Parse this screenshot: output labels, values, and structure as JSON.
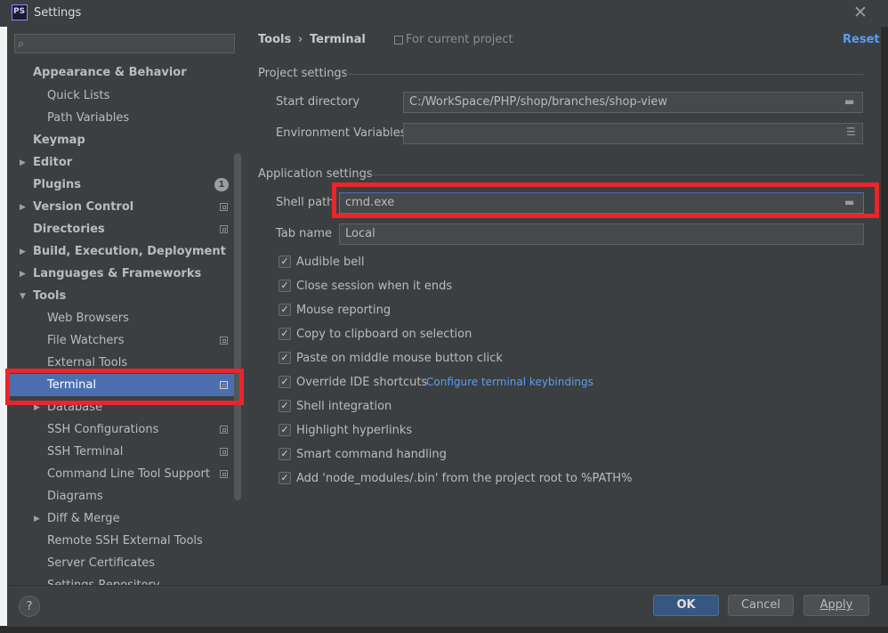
{
  "window": {
    "title": "Settings",
    "icon_text": "PS",
    "close_icon": "close-icon"
  },
  "search": {
    "placeholder": ""
  },
  "sidebar": {
    "items": [
      {
        "label": "Appearance & Behavior",
        "bold": true
      },
      {
        "label": "Quick Lists"
      },
      {
        "label": "Path Variables"
      },
      {
        "label": "Keymap",
        "bold": true
      },
      {
        "label": "Editor",
        "bold": true
      },
      {
        "label": "Plugins",
        "bold": true,
        "badge": "1"
      },
      {
        "label": "Version Control",
        "bold": true
      },
      {
        "label": "Directories",
        "bold": true
      },
      {
        "label": "Build, Execution, Deployment",
        "bold": true
      },
      {
        "label": "Languages & Frameworks",
        "bold": true
      },
      {
        "label": "Tools",
        "bold": true
      },
      {
        "label": "Web Browsers"
      },
      {
        "label": "File Watchers"
      },
      {
        "label": "External Tools"
      },
      {
        "label": "Terminal",
        "selected": true
      },
      {
        "label": "Database"
      },
      {
        "label": "SSH Configurations"
      },
      {
        "label": "SSH Terminal"
      },
      {
        "label": "Command Line Tool Support"
      },
      {
        "label": "Diagrams"
      },
      {
        "label": "Diff & Merge"
      },
      {
        "label": "Remote SSH External Tools"
      },
      {
        "label": "Server Certificates"
      },
      {
        "label": "Settings Repository"
      }
    ]
  },
  "breadcrumb": {
    "root": "Tools",
    "separator": "›",
    "leaf": "Terminal"
  },
  "scope": {
    "text": "For current project"
  },
  "reset_label": "Reset",
  "project_settings": {
    "title": "Project settings",
    "start_directory_label": "Start directory",
    "start_directory_value": "C:/WorkSpace/PHP/shop/branches/shop-view",
    "env_label": "Environment Variables",
    "env_value": ""
  },
  "application_settings": {
    "title": "Application settings",
    "shell_path_label": "Shell path",
    "shell_path_value": "cmd.exe",
    "tab_name_label": "Tab name",
    "tab_name_value": "Local",
    "checkboxes": [
      {
        "label": "Audible bell",
        "checked": true
      },
      {
        "label": "Close session when it ends",
        "checked": true
      },
      {
        "label": "Mouse reporting",
        "checked": true
      },
      {
        "label": "Copy to clipboard on selection",
        "checked": true
      },
      {
        "label": "Paste on middle mouse button click",
        "checked": true
      },
      {
        "label": "Override IDE shortcuts",
        "checked": true
      },
      {
        "label": "Shell integration",
        "checked": true
      },
      {
        "label": "Highlight hyperlinks",
        "checked": true
      },
      {
        "label": "Smart command handling",
        "checked": true
      },
      {
        "label": "Add 'node_modules/.bin' from the project root to %PATH%",
        "checked": true
      }
    ],
    "configure_link": "Configure terminal keybindings"
  },
  "buttons": {
    "help": "?",
    "ok": "OK",
    "cancel": "Cancel",
    "apply": "Apply"
  },
  "colors": {
    "accent": "#4b6eaf",
    "link": "#589df6",
    "highlight_box": "#e8262c"
  }
}
